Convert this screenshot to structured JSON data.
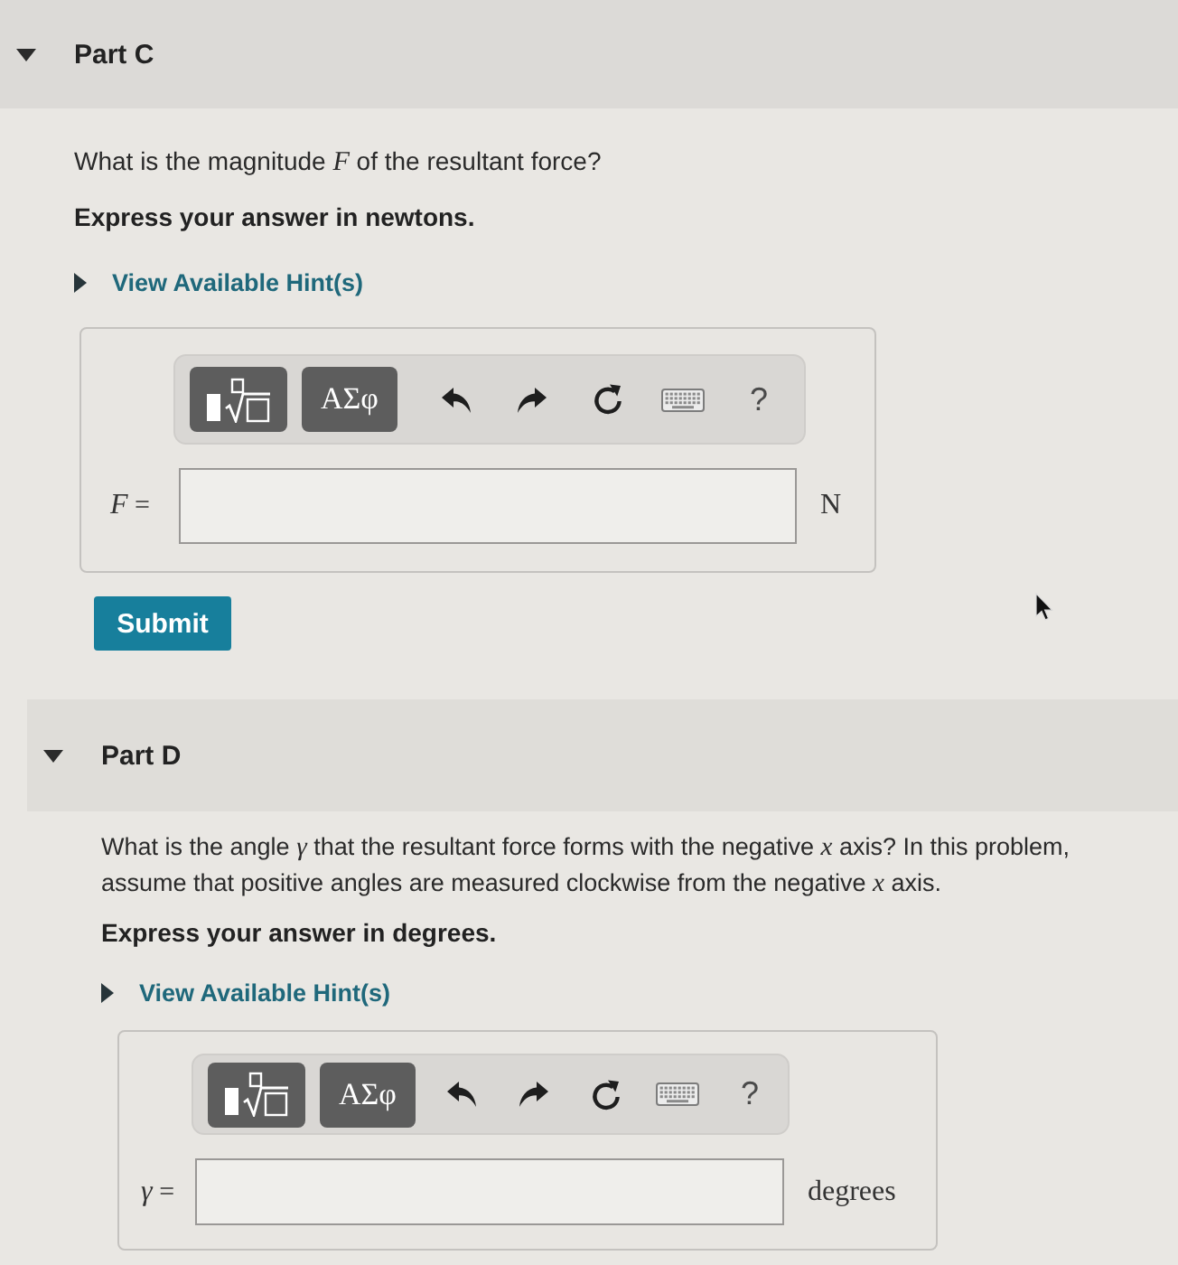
{
  "parts": [
    {
      "title": "Part C",
      "expanded": true,
      "question": "What is the magnitude *F* of the resultant force?",
      "instruction": "Express your answer in newtons.",
      "hint": {
        "label": "View Available Hint(s)",
        "expanded": false
      },
      "answer": {
        "toolbar": [
          {
            "kind": "templates"
          },
          {
            "kind": "symbols",
            "label": "ΑΣφ"
          },
          {
            "kind": "undo"
          },
          {
            "kind": "redo"
          },
          {
            "kind": "reset"
          },
          {
            "kind": "keyboard"
          },
          {
            "kind": "help",
            "label": "?"
          }
        ],
        "label": "*F* =",
        "units": "N"
      },
      "submit": "Submit"
    },
    {
      "title": "Part D",
      "expanded": true,
      "question": "What is the angle *γ* that the resultant force forms with the negative *x* axis? In this problem, assume that positive angles are measured clockwise from the negative *x* axis.",
      "instruction": "Express your answer in degrees.",
      "hint": {
        "label": "View Available Hint(s)",
        "expanded": false
      },
      "answer": {
        "toolbar": [
          {
            "kind": "templates"
          },
          {
            "kind": "symbols",
            "label": "ΑΣφ"
          },
          {
            "kind": "undo"
          },
          {
            "kind": "redo"
          },
          {
            "kind": "reset"
          },
          {
            "kind": "keyboard"
          },
          {
            "kind": "help",
            "label": "?"
          }
        ],
        "label": "*γ* =",
        "units": "degrees"
      }
    }
  ]
}
